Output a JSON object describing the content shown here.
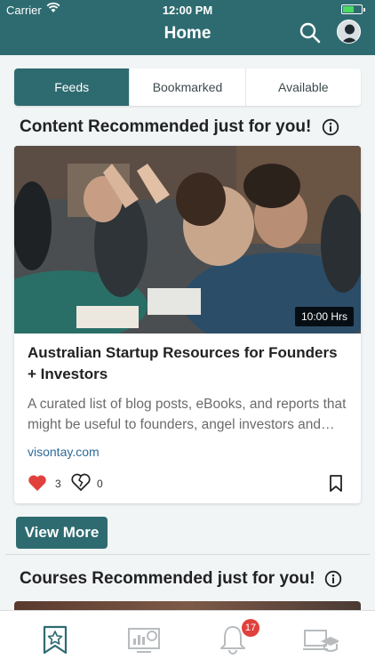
{
  "status_bar": {
    "carrier": "Carrier",
    "time": "12:00 PM"
  },
  "nav": {
    "title": "Home",
    "icons": [
      "search-icon",
      "avatar"
    ]
  },
  "tabs": [
    {
      "label": "Feeds",
      "active": true
    },
    {
      "label": "Bookmarked",
      "active": false
    },
    {
      "label": "Available",
      "active": false
    }
  ],
  "content_section": {
    "title": "Content Recommended just for you!",
    "card": {
      "duration": "10:00 Hrs",
      "title": "Australian Startup Resources for Founders + Investors",
      "description": "A curated list of blog posts, eBooks, and reports that might be useful to founders, angel investors and VCs.",
      "link": "visontay.com",
      "likes": "3",
      "dislikes": "0"
    },
    "view_more_label": "View More"
  },
  "courses_section": {
    "title": "Courses Recommended just for you!"
  },
  "bottom_bar": {
    "items": [
      "bookmark-star-icon",
      "dashboard-icon",
      "bell-icon",
      "course-icon"
    ],
    "notification_count": "17"
  },
  "colors": {
    "primary": "#2e6b70",
    "like": "#e0413d",
    "link": "#2e6b9a"
  }
}
